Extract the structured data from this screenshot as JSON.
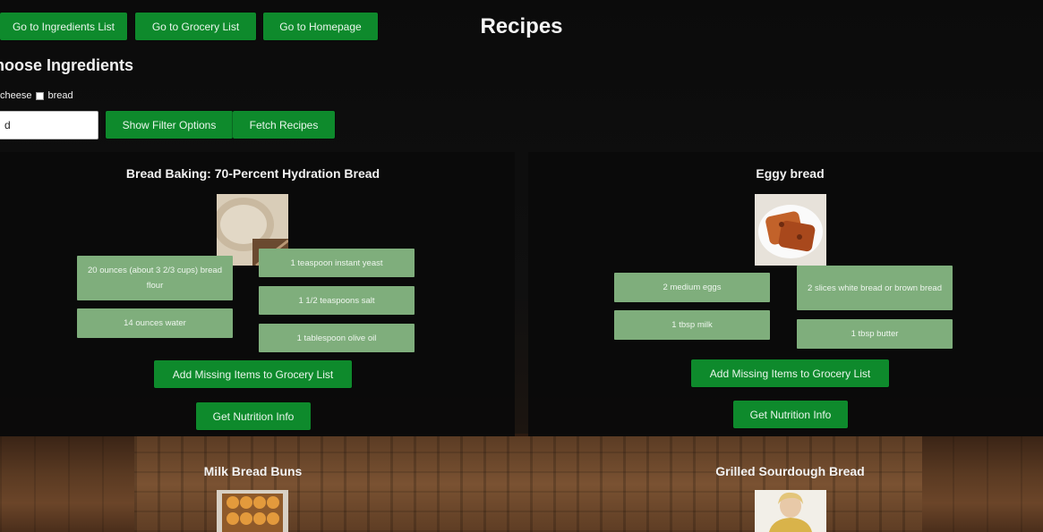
{
  "nav": {
    "ingredients_label": "Go to Ingredients List",
    "grocery_label": "Go to Grocery List",
    "home_label": "Go to Homepage"
  },
  "page_title": "Recipes",
  "filter": {
    "heading": "hoose Ingredients",
    "options": [
      "cheese",
      "bread"
    ],
    "input_value": "d",
    "show_filter_label": "Show Filter Options",
    "fetch_label": "Fetch Recipes"
  },
  "recipes": [
    {
      "title": "Bread Baking: 70-Percent Hydration Bread",
      "ingredients": [
        "20 ounces (about 3 2/3 cups) bread flour",
        "1 teaspoon instant yeast",
        "1 1/2 teaspoons salt",
        "14 ounces water",
        "1 tablespoon olive oil"
      ],
      "add_missing_label": "Add Missing Items to Grocery List",
      "nutrition_label": "Get Nutrition Info"
    },
    {
      "title": "Eggy bread",
      "ingredients": [
        "2 medium eggs",
        "2 slices white bread or brown bread",
        "1 tbsp milk",
        "1 tbsp butter"
      ],
      "add_missing_label": "Add Missing Items to Grocery List",
      "nutrition_label": "Get Nutrition Info"
    },
    {
      "title": "Milk Bread Buns"
    },
    {
      "title": "Grilled Sourdough Bread"
    }
  ],
  "colors": {
    "button_green": "#0e8a2c",
    "ingredient_green": "#7fae7c",
    "panel_bg": "#0a0a0a"
  }
}
